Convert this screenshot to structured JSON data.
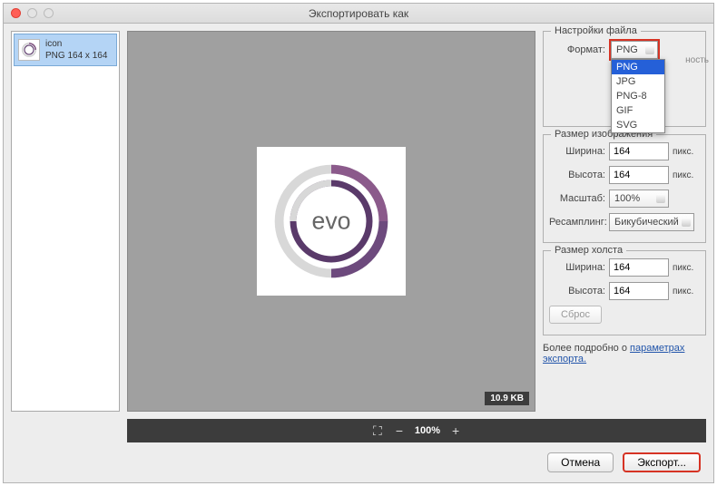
{
  "window": {
    "title": "Экспортировать как"
  },
  "sidebar": {
    "item": {
      "name": "icon",
      "meta": "PNG   164 x 164"
    }
  },
  "preview": {
    "filesize": "10.9 KB",
    "logo_text": "evo"
  },
  "zoom": {
    "value": "100%"
  },
  "file_settings": {
    "legend": "Настройки файла",
    "format_label": "Формат:",
    "format_value": "PNG",
    "options": [
      "PNG",
      "JPG",
      "PNG-8",
      "GIF",
      "SVG"
    ],
    "obscured_suffix": "ность"
  },
  "image_size": {
    "legend": "Размер изображения",
    "width_label": "Ширина:",
    "width_value": "164",
    "height_label": "Высота:",
    "height_value": "164",
    "scale_label": "Масштаб:",
    "scale_value": "100%",
    "resample_label": "Ресамплинг:",
    "resample_value": "Бикубический",
    "unit": "пикс."
  },
  "canvas_size": {
    "legend": "Размер холста",
    "width_label": "Ширина:",
    "width_value": "164",
    "height_label": "Высота:",
    "height_value": "164",
    "unit": "пикс.",
    "reset": "Сброс"
  },
  "more_info": {
    "prefix": "Более подробно о ",
    "link": "параметрах экспорта."
  },
  "footer": {
    "cancel": "Отмена",
    "export": "Экспорт..."
  }
}
